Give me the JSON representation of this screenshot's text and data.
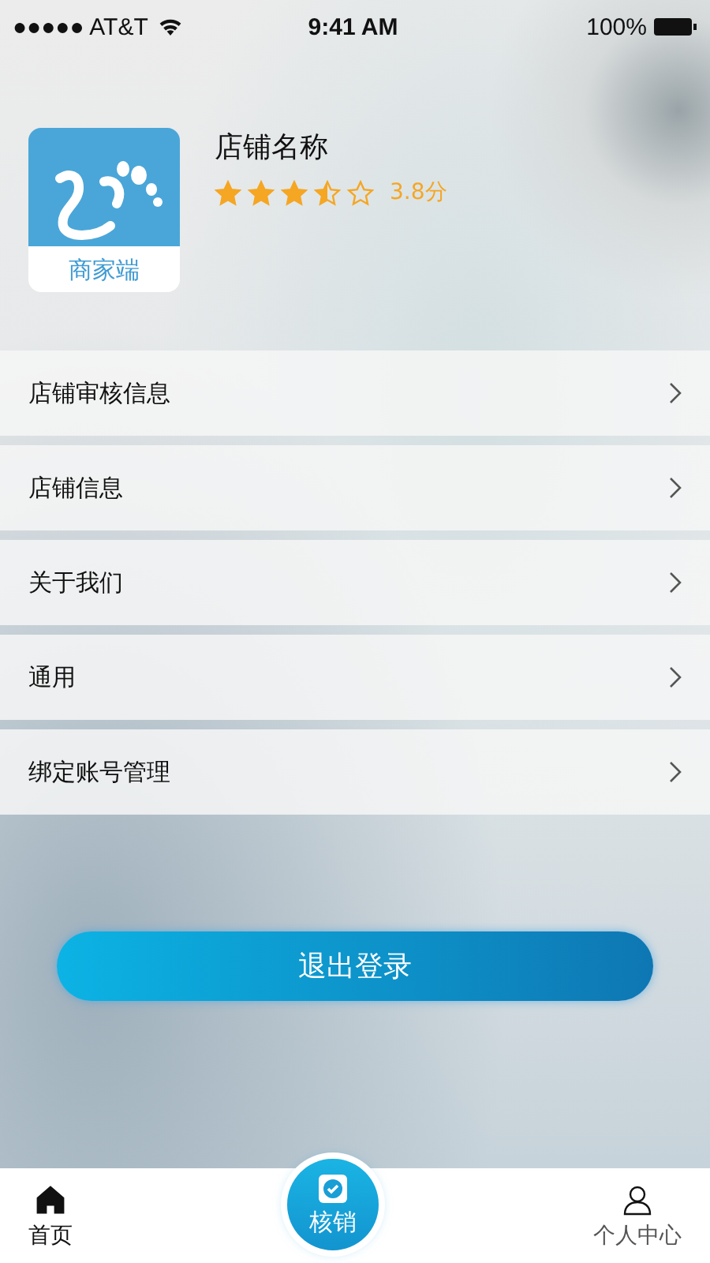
{
  "status_bar": {
    "carrier": "●●●●● AT&T",
    "time": "9:41 AM",
    "battery": "100%"
  },
  "store": {
    "logo_caption": "商家端",
    "name": "店铺名称",
    "stars": 3.5,
    "score": "3.8分"
  },
  "menu": [
    {
      "label": "店铺审核信息"
    },
    {
      "label": "店铺信息"
    },
    {
      "label": "关于我们"
    },
    {
      "label": "通用"
    },
    {
      "label": "绑定账号管理"
    }
  ],
  "logout_button": "退出登录",
  "tab_bar": [
    {
      "kind": "home",
      "label": "首页",
      "selected": true
    },
    {
      "kind": "verify",
      "label": "核销",
      "selected": false
    },
    {
      "kind": "profile",
      "label": "个人中心",
      "selected": false
    }
  ]
}
